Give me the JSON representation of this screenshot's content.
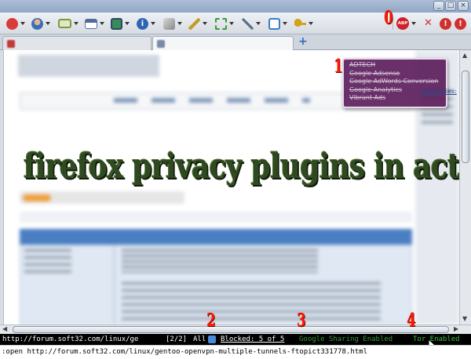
{
  "window": {
    "title": ""
  },
  "toolbar": {
    "items": [
      {
        "name": "stop-icon",
        "color": "#d93b3b"
      },
      {
        "name": "user-icon",
        "color": "#3a6fb8"
      },
      {
        "name": "card-icon",
        "color": "#7c9a3a"
      },
      {
        "name": "layout-icon",
        "color": "#4f6d9c"
      },
      {
        "name": "screen-icon",
        "color": "#3a8a5a"
      },
      {
        "name": "info-icon",
        "color": "#2f64b3"
      },
      {
        "name": "cube-icon",
        "color": "#888888"
      },
      {
        "name": "pen-icon",
        "color": "#c49a2a"
      },
      {
        "name": "resize-icon",
        "color": "#3a9a3a"
      },
      {
        "name": "wrench-icon",
        "color": "#5a6f8a"
      },
      {
        "name": "document-icon",
        "color": "#3a7fc4"
      },
      {
        "name": "key-icon",
        "color": "#d3a21c"
      }
    ],
    "adblock_label": "ABP",
    "close_symbol": "✕",
    "warning_symbol": "!"
  },
  "tabs": [
    {
      "label": ""
    },
    {
      "label": ""
    }
  ],
  "new_tab_symbol": "+",
  "annotations": {
    "title": "firefox privacy plugins in action",
    "numbers": [
      "0",
      "1",
      "2",
      "3",
      "4"
    ]
  },
  "blocked_popup": {
    "items": [
      "ADTECH",
      "Google Adsense",
      "Google AdWords Conversion",
      "Google Analytics",
      "Vibrant Ads"
    ]
  },
  "statusbar": {
    "url": "http://forum.soft32.com/linux/ge",
    "tab_count": "[2/2]",
    "all_label": "All",
    "blocked": "Blocked: 5 of 5",
    "sharing": "Google Sharing Enabled",
    "tor": "Tor Enabled"
  },
  "command_line": ":open http://forum.soft32.com/linux/gentoo-openvpn-multiple-tunnels-ftopict331778.html",
  "colors": {
    "statusbar_bg": "#000000",
    "url_text": "#ffffff",
    "blocked_text": "#ffffff",
    "sharing_text": "#3a9a3a",
    "tor_text": "#3fc33f",
    "popup_bg": "#5c1e5c",
    "annotation_red": "#ff1a00",
    "overlay_green": "#2f4a21"
  }
}
